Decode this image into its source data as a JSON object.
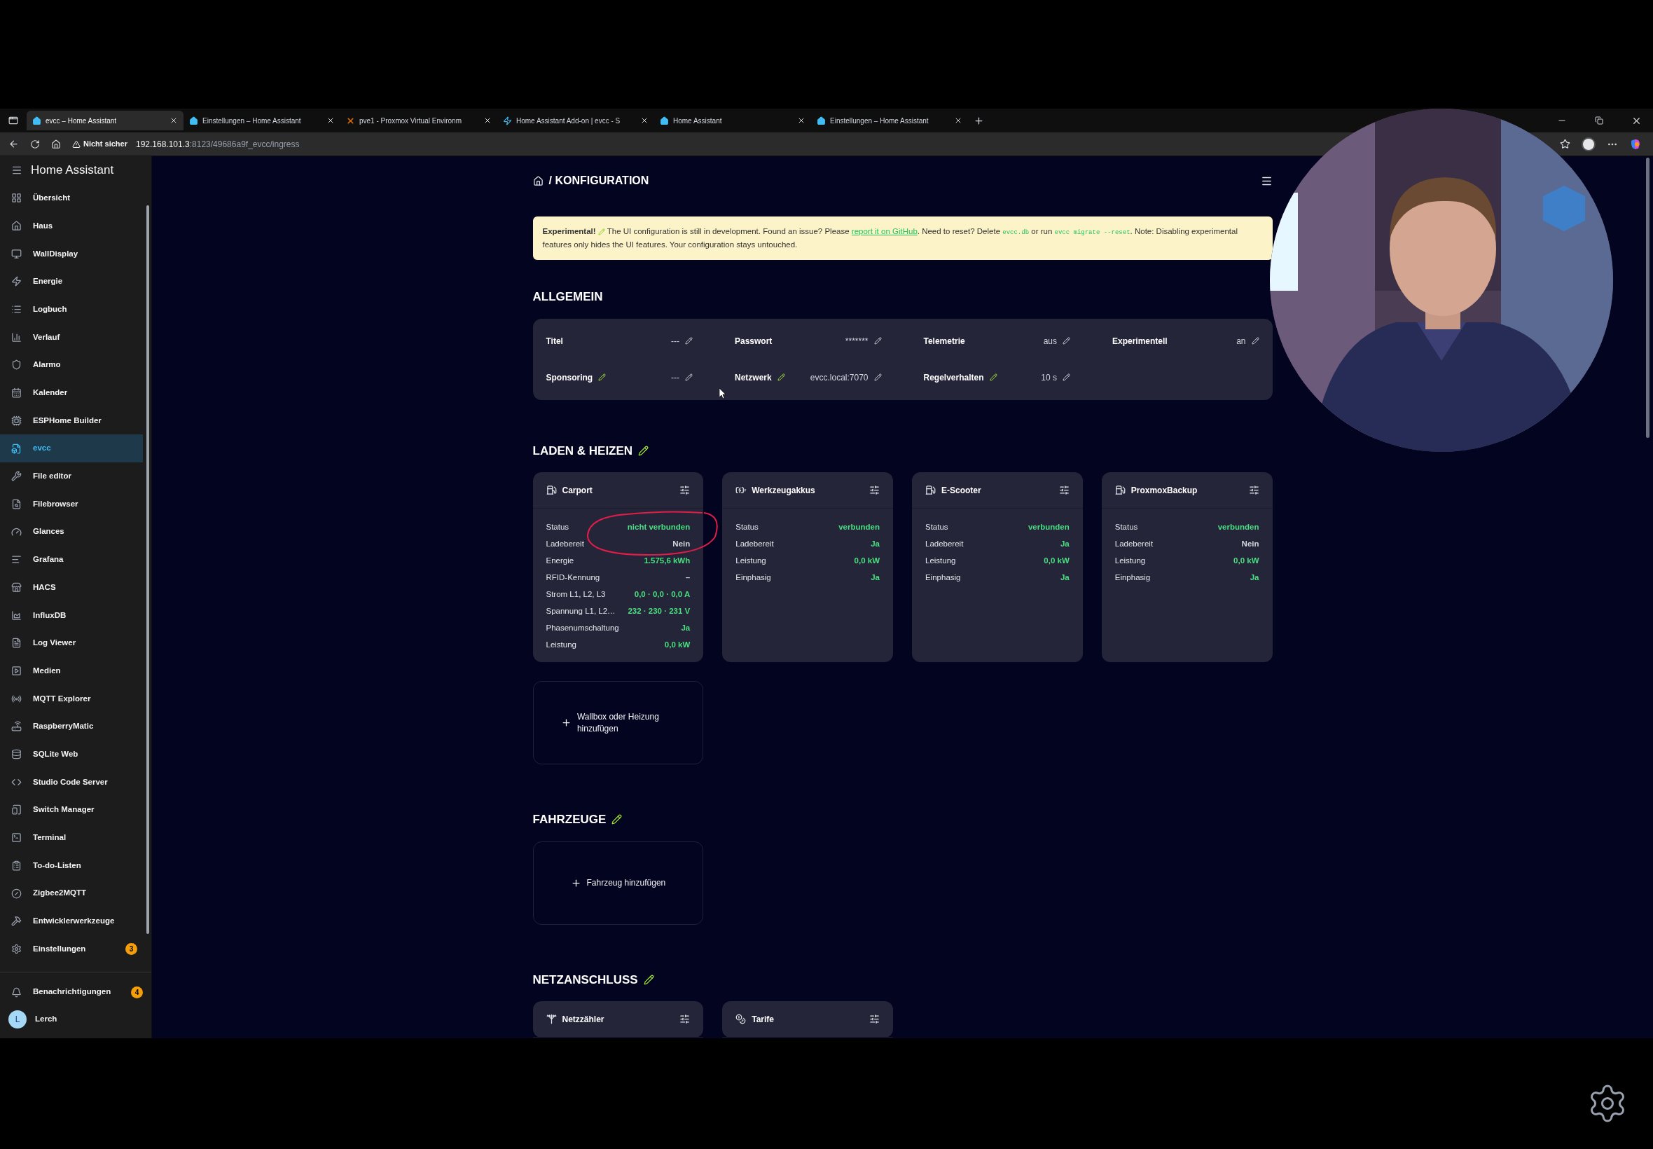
{
  "browser": {
    "tabs": [
      {
        "title": "evcc – Home Assistant",
        "selected": true
      },
      {
        "title": "Einstellungen – Home Assistant",
        "selected": false
      },
      {
        "title": "pve1 - Proxmox Virtual Environm",
        "selected": false
      },
      {
        "title": "Home Assistant Add-on | evcc - S",
        "selected": false
      },
      {
        "title": "Home Assistant",
        "selected": false
      },
      {
        "title": "Einstellungen – Home Assistant",
        "selected": false
      }
    ],
    "security_label": "Nicht sicher",
    "url_host": "192.168.101.3",
    "url_rest": ":8123/49686a9f_evcc/ingress"
  },
  "sidebar": {
    "title": "Home Assistant",
    "items": [
      {
        "label": "Übersicht",
        "selected": false
      },
      {
        "label": "Haus",
        "selected": false
      },
      {
        "label": "WallDisplay",
        "selected": false
      },
      {
        "label": "Energie",
        "selected": false
      },
      {
        "label": "Logbuch",
        "selected": false
      },
      {
        "label": "Verlauf",
        "selected": false
      },
      {
        "label": "Alarmo",
        "selected": false
      },
      {
        "label": "Kalender",
        "selected": false
      },
      {
        "label": "ESPHome Builder",
        "selected": false
      },
      {
        "label": "evcc",
        "selected": true
      },
      {
        "label": "File editor",
        "selected": false
      },
      {
        "label": "Filebrowser",
        "selected": false
      },
      {
        "label": "Glances",
        "selected": false
      },
      {
        "label": "Grafana",
        "selected": false
      },
      {
        "label": "HACS",
        "selected": false
      },
      {
        "label": "InfluxDB",
        "selected": false
      },
      {
        "label": "Log Viewer",
        "selected": false
      },
      {
        "label": "Medien",
        "selected": false
      },
      {
        "label": "MQTT Explorer",
        "selected": false
      },
      {
        "label": "RaspberryMatic",
        "selected": false
      },
      {
        "label": "SQLite Web",
        "selected": false
      },
      {
        "label": "Studio Code Server",
        "selected": false
      },
      {
        "label": "Switch Manager",
        "selected": false
      },
      {
        "label": "Terminal",
        "selected": false
      },
      {
        "label": "To-do-Listen",
        "selected": false
      },
      {
        "label": "Zigbee2MQTT",
        "selected": false
      },
      {
        "label": "Entwicklerwerkzeuge",
        "selected": false
      },
      {
        "label": "Einstellungen",
        "selected": false,
        "badge": "3"
      }
    ],
    "notifications": {
      "label": "Benachrichtigungen",
      "badge": "4"
    },
    "user": {
      "initial": "L",
      "name": "Lerch"
    }
  },
  "page": {
    "breadcrumb_separator": "/",
    "breadcrumb": "KONFIGURATION",
    "banner": {
      "lead": "Experimental!",
      "text_1": "The UI configuration is still in development. Found an issue? Please",
      "link": "report it on GitHub",
      "text_2": ". Need to reset? Delete",
      "code_1": "evcc.db",
      "text_3": "or run",
      "code_2": "evcc migrate --reset",
      "text_4": ". Note: Disabling experimental features only hides the UI features. Your configuration stays untouched."
    },
    "general": {
      "title": "ALLGEMEIN",
      "fields": [
        {
          "label": "Titel",
          "value": "---",
          "experimental": false
        },
        {
          "label": "Passwort",
          "value": "*******",
          "experimental": false
        },
        {
          "label": "Telemetrie",
          "value": "aus",
          "experimental": false
        },
        {
          "label": "Experimentell",
          "value": "an",
          "experimental": false
        },
        {
          "label": "Sponsoring",
          "value": "---",
          "experimental": true
        },
        {
          "label": "Netzwerk",
          "value": "evcc.local:7070",
          "experimental": true
        },
        {
          "label": "Regelverhalten",
          "value": "10 s",
          "experimental": true
        }
      ]
    },
    "loadpoints": {
      "title": "LADEN & HEIZEN",
      "experimental": true,
      "add_label": "Wallbox oder Heizung hinzufügen",
      "cards": [
        {
          "title": "Carport",
          "rows": [
            {
              "label": "Status",
              "value": "nicht verbunden",
              "highlight": true
            },
            {
              "label": "Ladebereit",
              "value": "Nein",
              "highlight": false
            },
            {
              "label": "Energie",
              "value": "1.575,6 kWh",
              "highlight": true
            },
            {
              "label": "RFID-Kennung",
              "value": "–",
              "highlight": false
            },
            {
              "label": "Strom L1, L2, L3",
              "value": "0,0 · 0,0 · 0,0 A",
              "highlight": true
            },
            {
              "label": "Spannung L1, L2…",
              "value": "232 · 230 · 231 V",
              "highlight": true
            },
            {
              "label": "Phasenumschaltung",
              "value": "Ja",
              "highlight": true
            },
            {
              "label": "Leistung",
              "value": "0,0 kW",
              "highlight": true
            }
          ]
        },
        {
          "title": "Werkzeugakkus",
          "rows": [
            {
              "label": "Status",
              "value": "verbunden",
              "highlight": true
            },
            {
              "label": "Ladebereit",
              "value": "Ja",
              "highlight": true
            },
            {
              "label": "Leistung",
              "value": "0,0 kW",
              "highlight": true
            },
            {
              "label": "Einphasig",
              "value": "Ja",
              "highlight": true
            }
          ]
        },
        {
          "title": "E-Scooter",
          "rows": [
            {
              "label": "Status",
              "value": "verbunden",
              "highlight": true
            },
            {
              "label": "Ladebereit",
              "value": "Ja",
              "highlight": true
            },
            {
              "label": "Leistung",
              "value": "0,0 kW",
              "highlight": true
            },
            {
              "label": "Einphasig",
              "value": "Ja",
              "highlight": true
            }
          ]
        },
        {
          "title": "ProxmoxBackup",
          "rows": [
            {
              "label": "Status",
              "value": "verbunden",
              "highlight": true
            },
            {
              "label": "Ladebereit",
              "value": "Nein",
              "highlight": false
            },
            {
              "label": "Leistung",
              "value": "0,0 kW",
              "highlight": true
            },
            {
              "label": "Einphasig",
              "value": "Ja",
              "highlight": true
            }
          ]
        }
      ]
    },
    "vehicles": {
      "title": "FAHRZEUGE",
      "experimental": true,
      "add_label": "Fahrzeug hinzufügen"
    },
    "grid": {
      "title": "NETZANSCHLUSS",
      "experimental": true,
      "cards": [
        {
          "title": "Netzzähler"
        },
        {
          "title": "Tarife"
        }
      ]
    }
  }
}
